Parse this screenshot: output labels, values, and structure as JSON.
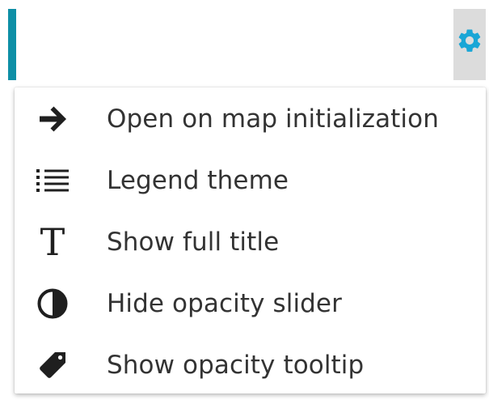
{
  "colors": {
    "accent": "#0e8fa6",
    "gear": "#1aa6d6",
    "icon": "#1f1f1f",
    "text": "#333333"
  },
  "header": {
    "settings_icon": "gear-icon"
  },
  "menu": {
    "items": [
      {
        "icon": "arrow-right-icon",
        "label": "Open on map initialization"
      },
      {
        "icon": "list-icon",
        "label": "Legend theme"
      },
      {
        "icon": "text-t-icon",
        "label": "Show full title",
        "glyph": "T"
      },
      {
        "icon": "half-circle-icon",
        "label": "Hide opacity slider"
      },
      {
        "icon": "tag-icon",
        "label": "Show opacity tooltip"
      }
    ]
  }
}
